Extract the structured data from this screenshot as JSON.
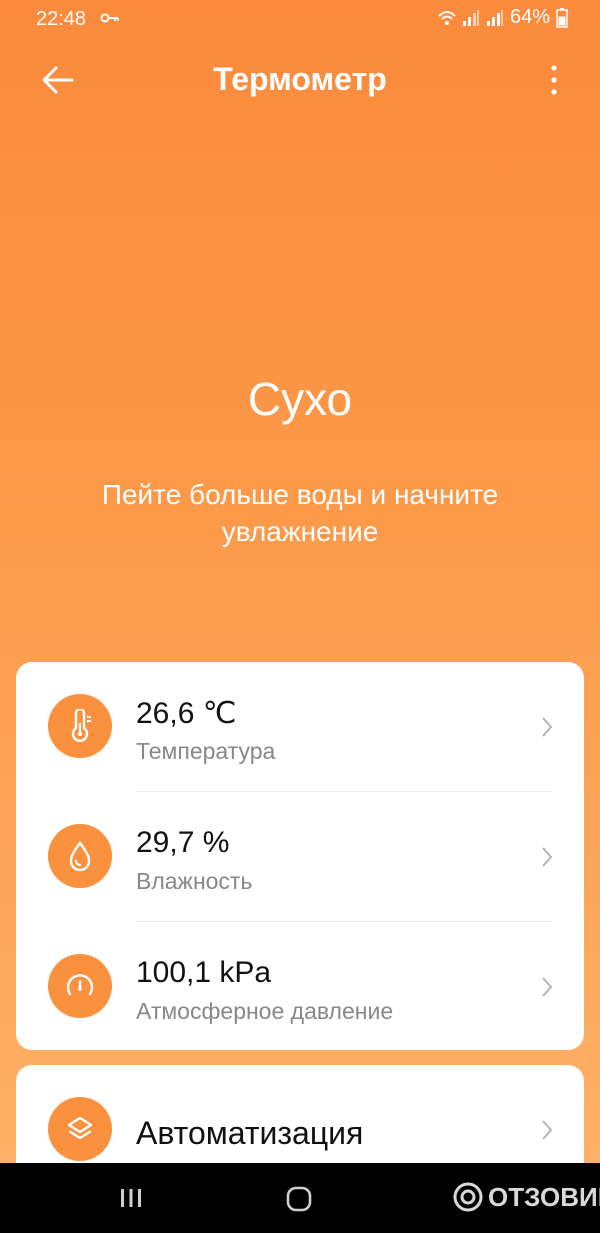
{
  "status_bar": {
    "time": "22:48",
    "battery": "64%",
    "battery_level": 0.64
  },
  "app_bar": {
    "title": "Термометр"
  },
  "condition": {
    "headline": "Сухо",
    "message": "Пейте больше воды и начните увлажнение"
  },
  "sensors": [
    {
      "value": "26,6 ℃",
      "label": "Температура",
      "icon": "thermometer-icon"
    },
    {
      "value": "29,7 %",
      "label": "Влажность",
      "icon": "water-drop-icon"
    },
    {
      "value": "100,1 kPa",
      "label": "Атмосферное давление",
      "icon": "gauge-icon"
    }
  ],
  "automation": {
    "label": "Автоматизация",
    "icon": "layers-icon"
  },
  "watermark": {
    "text": "ОТЗОВИК"
  },
  "colors": {
    "accent": "#fa913e",
    "gradient_top": "#fb8a3c",
    "gradient_bottom": "#fdb067"
  }
}
